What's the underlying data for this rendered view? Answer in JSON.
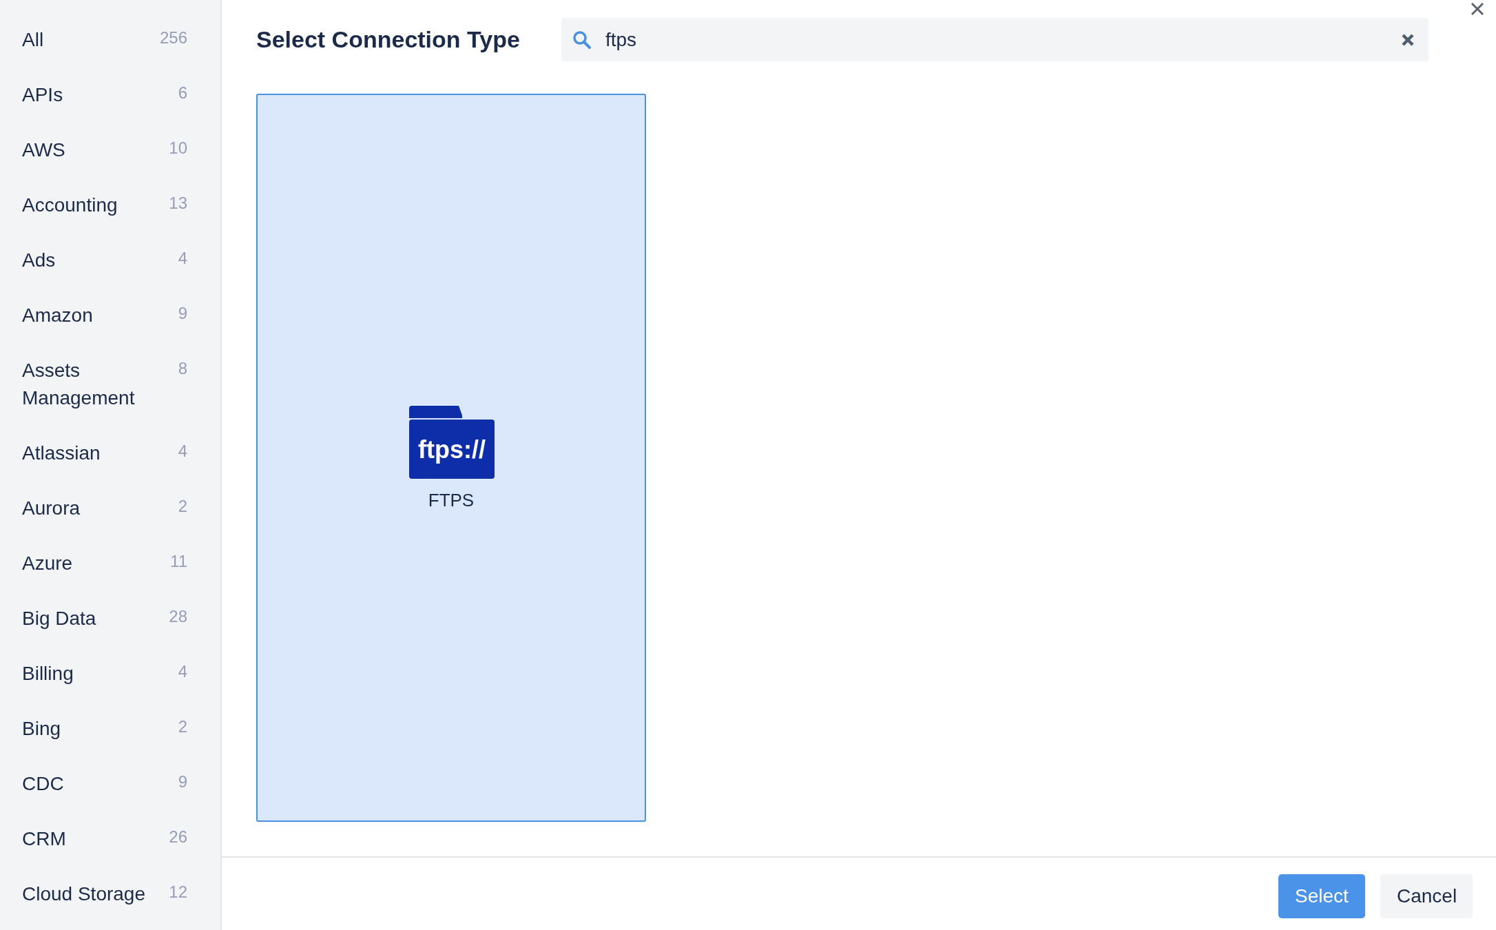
{
  "sidebar": {
    "items": [
      {
        "label": "All",
        "count": "256"
      },
      {
        "label": "APIs",
        "count": "6"
      },
      {
        "label": "AWS",
        "count": "10"
      },
      {
        "label": "Accounting",
        "count": "13"
      },
      {
        "label": "Ads",
        "count": "4"
      },
      {
        "label": "Amazon",
        "count": "9"
      },
      {
        "label": "Assets Management",
        "count": "8"
      },
      {
        "label": "Atlassian",
        "count": "4"
      },
      {
        "label": "Aurora",
        "count": "2"
      },
      {
        "label": "Azure",
        "count": "11"
      },
      {
        "label": "Big Data",
        "count": "28"
      },
      {
        "label": "Billing",
        "count": "4"
      },
      {
        "label": "Bing",
        "count": "2"
      },
      {
        "label": "CDC",
        "count": "9"
      },
      {
        "label": "CRM",
        "count": "26"
      },
      {
        "label": "Cloud Storage",
        "count": "12"
      }
    ]
  },
  "dialog": {
    "title": "Select Connection Type",
    "search": {
      "value": "ftps"
    },
    "results": [
      {
        "label": "FTPS",
        "icon_text": "ftps://",
        "selected": true
      }
    ],
    "buttons": [
      {
        "label": "Select",
        "kind": "primary"
      },
      {
        "label": "Cancel",
        "kind": "secondary"
      }
    ]
  }
}
